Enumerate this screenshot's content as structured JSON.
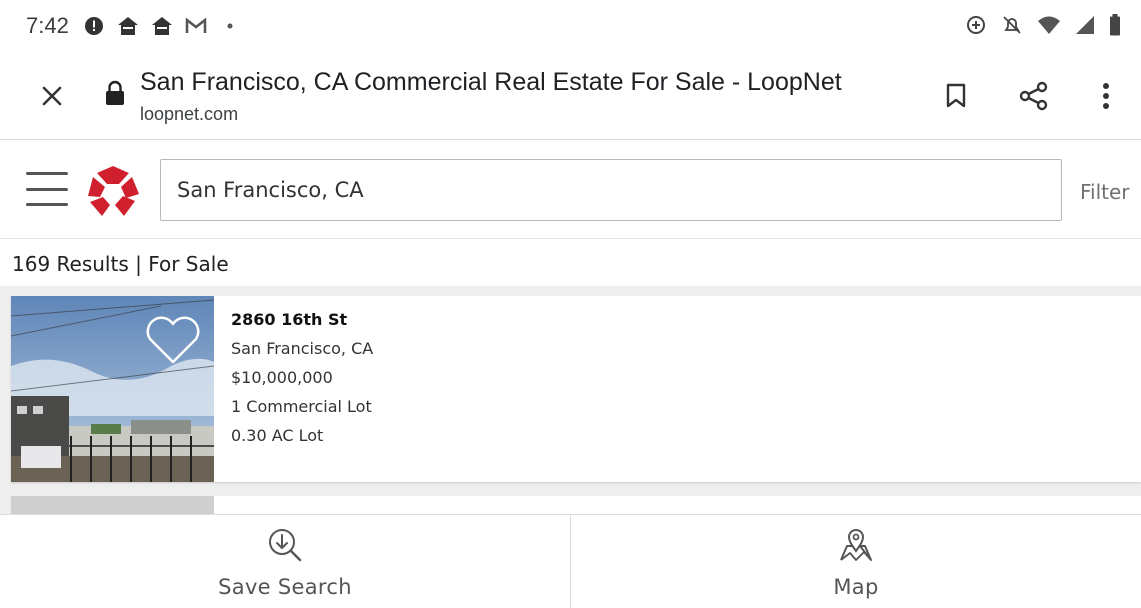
{
  "status_bar": {
    "time": "7:42",
    "left_icons": [
      "alert-icon",
      "home-icon",
      "home-icon",
      "gmail-icon",
      "dot-icon"
    ],
    "right_icons": [
      "data-saver-icon",
      "mute-icon",
      "wifi-icon",
      "signal-icon",
      "battery-icon"
    ]
  },
  "browser": {
    "page_title": "San Francisco, CA Commercial Real Estate For Sale - LoopNet",
    "url": "loopnet.com"
  },
  "site": {
    "search_value": "San Francisco, CA",
    "filter_label": "Filter",
    "brand_color": "#d0202e"
  },
  "results": {
    "count_label": "169 Results | For Sale"
  },
  "listings": [
    {
      "address": "2860 16th St",
      "city": "San Francisco, CA",
      "price": "$10,000,000",
      "type": "1 Commercial Lot",
      "lot_size": "0.30 AC Lot"
    }
  ],
  "bottom_bar": {
    "save_search_label": "Save Search",
    "map_label": "Map"
  }
}
